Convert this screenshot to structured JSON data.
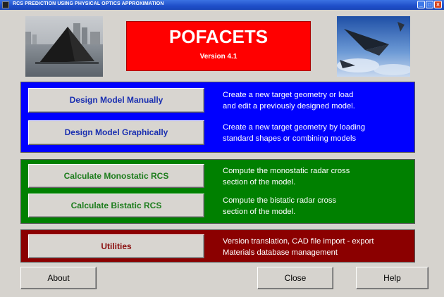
{
  "window": {
    "title": "RCS PREDICTION USING PHYSICAL OPTICS APPROXIMATION",
    "controls": {
      "minimize": "_",
      "maximize": "□",
      "close": "×"
    }
  },
  "banner": {
    "title": "POFACETS",
    "version": "Version 4.1"
  },
  "design": {
    "color": "#0000ff",
    "manual_label": "Design Model Manually",
    "manual_desc": [
      "Create a new target geometry or load",
      "and edit a previously designed model."
    ],
    "graphical_label": "Design Model Graphically",
    "graphical_desc": [
      "Create a new target geometry by loading",
      "standard shapes or combining models"
    ]
  },
  "calculate": {
    "color": "#008000",
    "mono_label": "Calculate Monostatic RCS",
    "mono_desc": [
      "Compute the monostatic radar cross",
      "section of the model."
    ],
    "bi_label": "Calculate Bistatic RCS",
    "bi_desc": [
      "Compute the bistatic radar cross",
      "section of the model."
    ]
  },
  "utilities": {
    "color": "#8b0000",
    "label": "Utilities",
    "desc": [
      "Version translation, CAD file import - export",
      "Materials database management"
    ]
  },
  "bottom": {
    "about": "About",
    "close": "Close",
    "help": "Help"
  }
}
